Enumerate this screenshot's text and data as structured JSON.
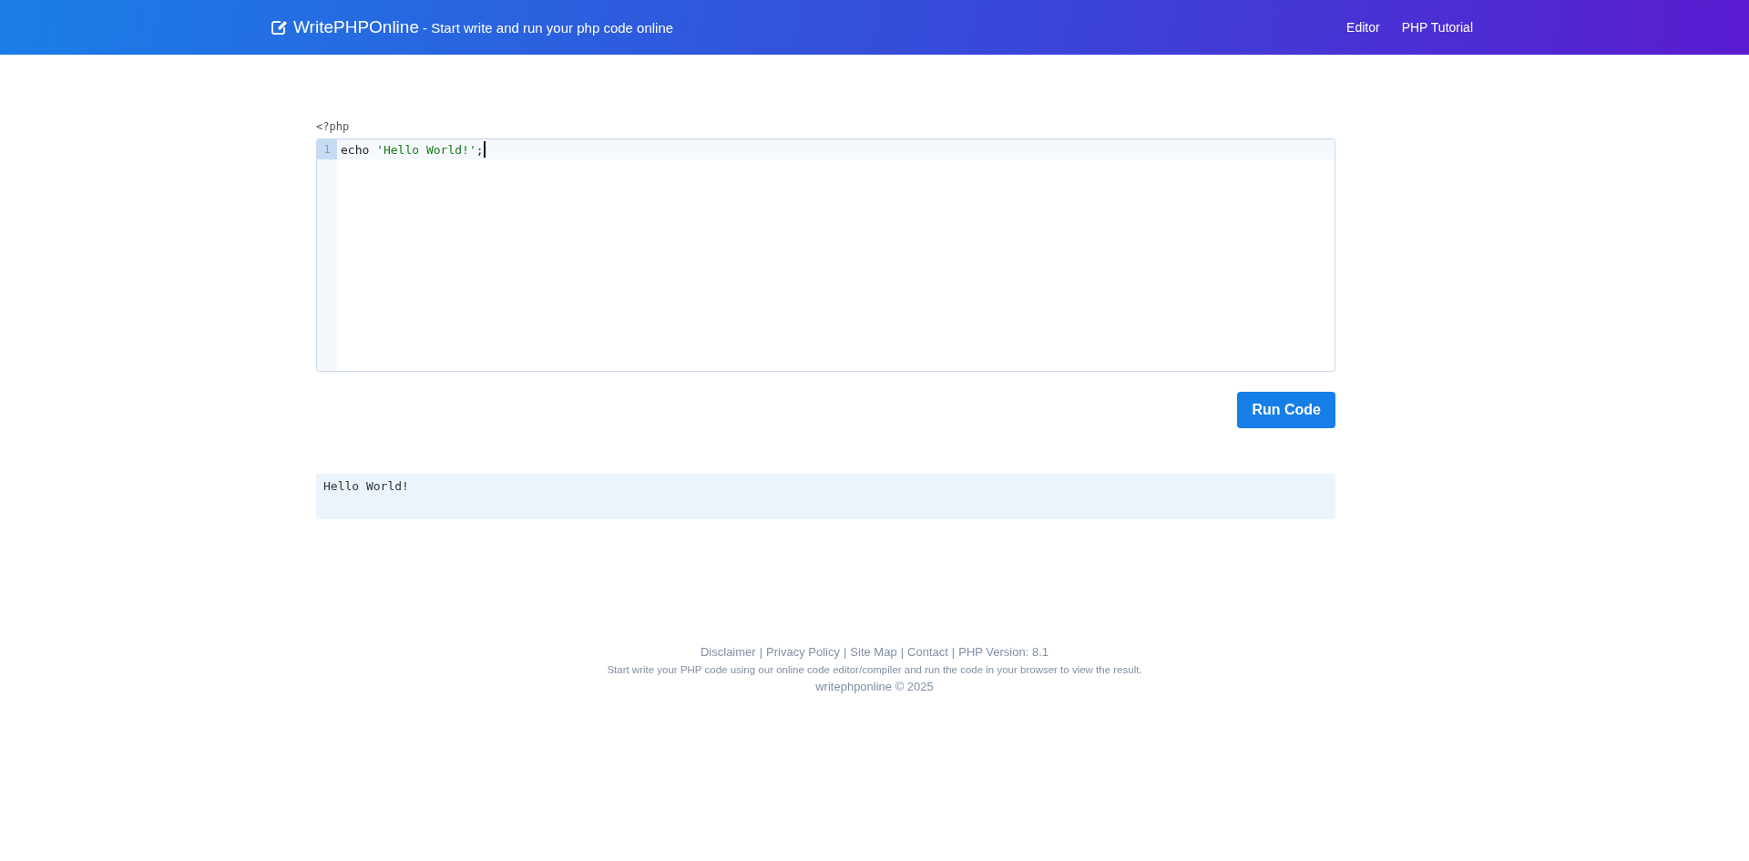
{
  "navbar": {
    "brand": "WritePHPOnline",
    "tagline": "- Start write and run your php code online",
    "links": [
      {
        "label": "Editor"
      },
      {
        "label": "PHP Tutorial"
      }
    ]
  },
  "editor": {
    "prolog": "<?php",
    "lines": [
      {
        "number": "1",
        "active": true,
        "cursor": true,
        "tokens": [
          {
            "kind": "keyword",
            "text": "echo "
          },
          {
            "kind": "string",
            "text": "'Hello World!'"
          },
          {
            "kind": "plain",
            "text": ";"
          }
        ]
      }
    ]
  },
  "run_button": "Run Code",
  "output": "Hello World!",
  "footer": {
    "links": [
      "Disclaimer",
      "Privacy Policy",
      "Site Map",
      "Contact"
    ],
    "separator": "|",
    "version": "PHP Version: 8.1",
    "description": "Start write your PHP code using our online code editor/compiler and run the code in your browser to view the result.",
    "copyright": "writephponline © 2025"
  }
}
